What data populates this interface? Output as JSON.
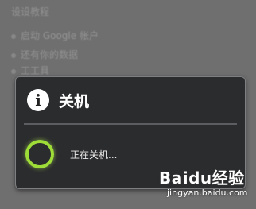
{
  "background": {
    "lines": [
      "设设教程",
      "启动 Google 帐户",
      "还有你的数据",
      "工工具"
    ]
  },
  "dialog": {
    "title": "关机",
    "message": "正在关机...",
    "icon": "info-icon",
    "accent_color": "#9edc38"
  },
  "watermark": {
    "logo_text": "Baidu经验",
    "url": "jingyan.baidu.com"
  }
}
